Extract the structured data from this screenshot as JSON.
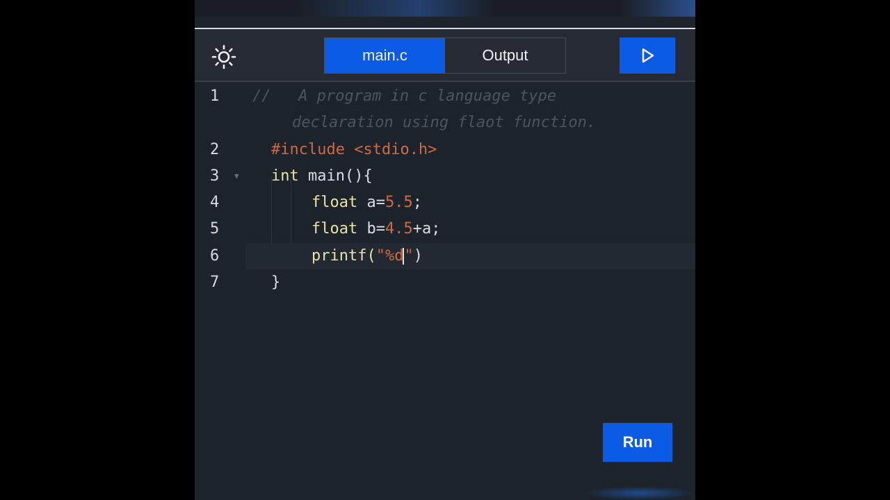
{
  "header": {
    "theme_icon": "sun-icon",
    "tabs": [
      {
        "label": "main.c",
        "active": true
      },
      {
        "label": "Output",
        "active": false
      }
    ],
    "play_icon": "play-icon"
  },
  "editor": {
    "lines": [
      {
        "number": "1",
        "text": "//   A program in c language type",
        "text_cont": "declaration using flaot function."
      },
      {
        "number": "2",
        "include": "#include",
        "header": "<stdio.h>"
      },
      {
        "number": "3",
        "kw": "int",
        "rest": " main(){"
      },
      {
        "number": "4",
        "kw": "float",
        "var": " a=",
        "num": "5.5",
        "end": ";"
      },
      {
        "number": "5",
        "kw": "float",
        "var": " b=",
        "num": "4.5",
        "plus": "+a",
        "end": ";"
      },
      {
        "number": "6",
        "fn": "printf(",
        "q1": "\"",
        "fmt": "%d",
        "q2": "\"",
        "close": ")"
      },
      {
        "number": "7",
        "brace": "}"
      }
    ]
  },
  "run_button": {
    "label": "Run"
  },
  "colors": {
    "accent": "#0c5be5",
    "background": "#1d232b",
    "header": "#262b33",
    "keyword": "#e8e2a6",
    "literal": "#d06a44",
    "comment": "#4e545c"
  }
}
